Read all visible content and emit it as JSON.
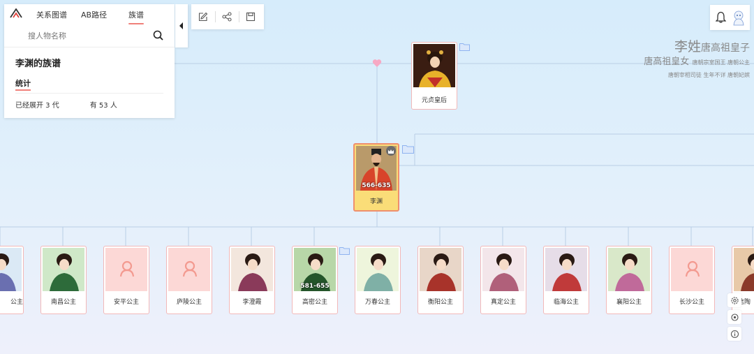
{
  "nav": {
    "tabs": [
      {
        "label": "关系图谱"
      },
      {
        "label": "AB路径"
      },
      {
        "label": "族谱"
      }
    ],
    "active_tab": "族谱"
  },
  "search": {
    "placeholder": "搜人物名称"
  },
  "info_panel": {
    "title": "李渊的族谱",
    "section_label": "统计",
    "expanded": "已经展开 3 代",
    "count": "有 53 人"
  },
  "watermark": {
    "line1_big": "李姓",
    "line1_small": "唐高祖皇子",
    "line2_big": "唐高祖皇女",
    "line2_small": "唐朝宗室国王 唐朝公主",
    "line3": "唐朝宰相司徒 生年不详 唐朝妃嫔"
  },
  "tree": {
    "spouse": {
      "name": "元贞皇后"
    },
    "main": {
      "name": "李渊",
      "years": "566-635"
    },
    "children": [
      {
        "name": "公主"
      },
      {
        "name": "南昌公主"
      },
      {
        "name": "安平公主"
      },
      {
        "name": "庐陵公主"
      },
      {
        "name": "李澄霞"
      },
      {
        "name": "高密公主",
        "years": "581-655"
      },
      {
        "name": "万春公主"
      },
      {
        "name": "衡阳公主"
      },
      {
        "name": "真定公主"
      },
      {
        "name": "临海公主"
      },
      {
        "name": "襄阳公主"
      },
      {
        "name": "长沙公主"
      },
      {
        "name": "信陶"
      }
    ]
  },
  "colors": {
    "accent": "#f0807a",
    "card_border": "#f2b8b8",
    "main_card_bg": "#fadd78",
    "folder": "#8fb3f0"
  },
  "icons": [
    "logo-icon",
    "search-icon",
    "collapse-icon",
    "edit-icon",
    "share-icon",
    "save-icon",
    "bell-icon",
    "avatar-icon",
    "heart-icon",
    "crown-icon",
    "folder-icon",
    "settings-icon",
    "locate-icon",
    "info-icon"
  ]
}
